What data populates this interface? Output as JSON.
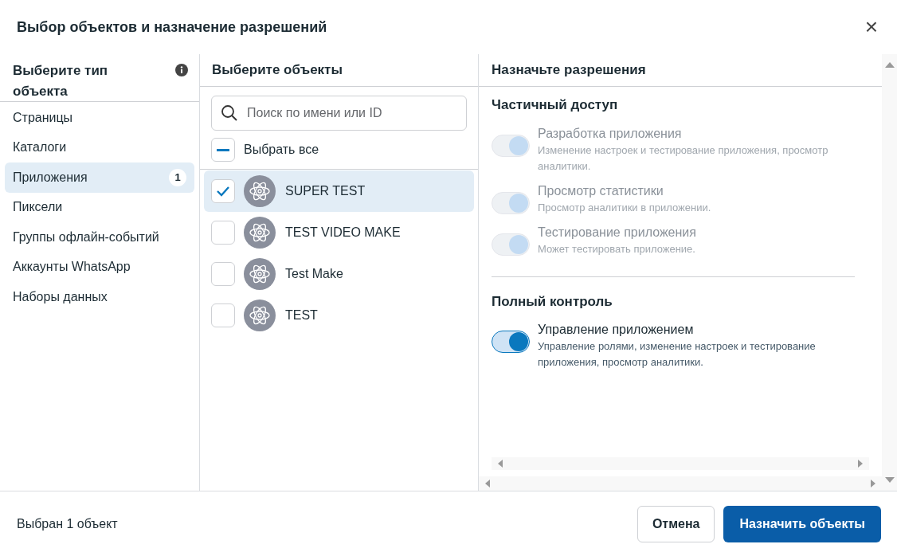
{
  "dialog": {
    "title": "Выбор объектов и назначение разрешений",
    "close": "×"
  },
  "types": {
    "heading": "Выберите тип объекта",
    "items": [
      {
        "label": "Страницы",
        "selected": false
      },
      {
        "label": "Каталоги",
        "selected": false
      },
      {
        "label": "Приложения",
        "selected": true,
        "count": "1"
      },
      {
        "label": "Пиксели",
        "selected": false
      },
      {
        "label": "Группы офлайн-событий",
        "selected": false
      },
      {
        "label": "Аккаунты WhatsApp",
        "selected": false
      },
      {
        "label": "Наборы данных",
        "selected": false
      }
    ]
  },
  "objects": {
    "heading": "Выберите объекты",
    "search": {
      "placeholder": "Поиск по имени или ID"
    },
    "select_all": {
      "label": "Выбрать все",
      "indeterminate": true
    },
    "items": [
      {
        "name": "SUPER TEST",
        "checked": true,
        "selected": true
      },
      {
        "name": "TEST VIDEO MAKE",
        "checked": false,
        "selected": false
      },
      {
        "name": "Test Make",
        "checked": false,
        "selected": false
      },
      {
        "name": "TEST",
        "checked": false,
        "selected": false
      }
    ]
  },
  "permissions": {
    "heading": "Назначьте разрешения",
    "groups": [
      {
        "title": "Частичный доступ",
        "items": [
          {
            "title": "Разработка приложения",
            "description": "Изменение настроек и тестирование приложения, просмотр аналитики.",
            "on": true,
            "disabled": true
          },
          {
            "title": "Просмотр статистики",
            "description": "Просмотр аналитики в приложении.",
            "on": true,
            "disabled": true
          },
          {
            "title": "Тестирование приложения",
            "description": "Может тестировать приложение.",
            "on": true,
            "disabled": true
          }
        ]
      },
      {
        "title": "Полный контроль",
        "items": [
          {
            "title": "Управление приложением",
            "description": "Управление ролями, изменение настроек и тестирование приложения, просмотр аналитики.",
            "on": true,
            "disabled": false
          }
        ]
      }
    ]
  },
  "footer": {
    "status": "Выбран 1 объект",
    "cancel": "Отмена",
    "submit": "Назначить объекты"
  }
}
